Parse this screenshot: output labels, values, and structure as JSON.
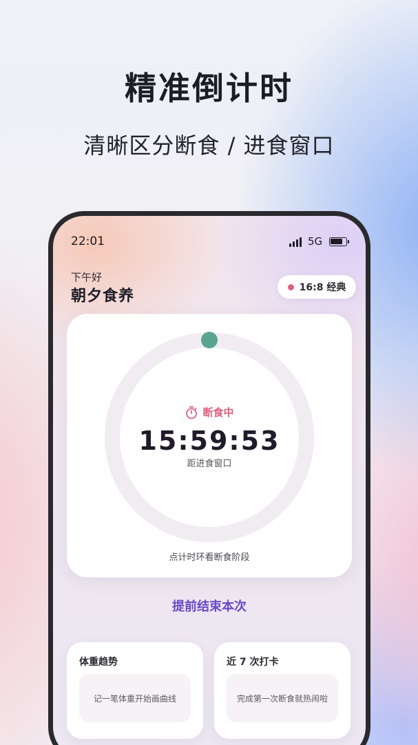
{
  "promo": {
    "headline": "精准倒计时",
    "subline": "清晰区分断食 / 进食窗口"
  },
  "status_bar": {
    "time": "22:01",
    "network": "5G"
  },
  "header": {
    "greeting": "下午好",
    "app_title": "朝夕食养",
    "plan_chip": "16:8 经典"
  },
  "timer": {
    "phase_label": "断食中",
    "countdown": "15:59:53",
    "countdown_caption": "距进食窗口",
    "ring_hint": "点计时环看断食阶段",
    "progress_fraction": 0.0
  },
  "actions": {
    "end_early": "提前结束本次"
  },
  "cards": {
    "weight": {
      "title": "体重趋势",
      "empty_text": "记一笔体重开始画曲线"
    },
    "checkin": {
      "title": "近 7 次打卡",
      "empty_text": "完成第一次断食就热闹啦"
    }
  },
  "colors": {
    "fasting_accent": "#e0607f",
    "action_purple": "#6a48c7",
    "progress_knob": "#5aa592",
    "ring_track": "#f1ecf1"
  },
  "icons": {
    "phase": "stopwatch-icon",
    "signal": "signal-bars-icon",
    "battery": "battery-icon"
  }
}
